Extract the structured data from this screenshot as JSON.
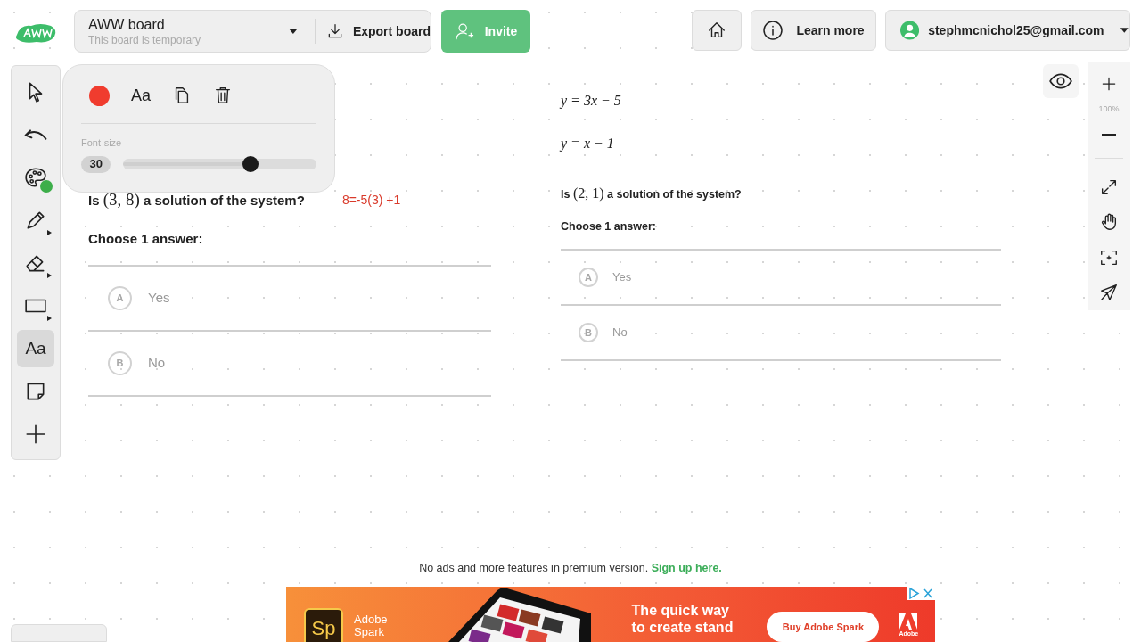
{
  "header": {
    "board_title": "AWW board",
    "board_subtitle": "This board is temporary",
    "export_label": "Export board",
    "invite_label": "Invite",
    "learn_more_label": "Learn more",
    "account_email": "stephmcnichol25@gmail.com"
  },
  "toolbar": {
    "tools": [
      {
        "kind": "select",
        "selected": false,
        "submenu": false
      },
      {
        "kind": "undo",
        "selected": false,
        "submenu": false
      },
      {
        "kind": "palette",
        "selected": false,
        "submenu": false
      },
      {
        "kind": "pencil",
        "selected": false,
        "submenu": true
      },
      {
        "kind": "eraser",
        "selected": false,
        "submenu": true
      },
      {
        "kind": "rectangle",
        "selected": false,
        "submenu": true
      },
      {
        "kind": "text",
        "label": "Aa",
        "selected": true,
        "submenu": false
      },
      {
        "kind": "note",
        "selected": false,
        "submenu": false
      },
      {
        "kind": "add",
        "selected": false,
        "submenu": false
      }
    ]
  },
  "text_popup": {
    "color": "#f03c2e",
    "font_label": "Aa",
    "font_size_label": "Font-size",
    "font_size": "30",
    "level": 0.66
  },
  "questions": [
    {
      "prompt_before": "Is",
      "point": "(3, 8)",
      "prompt_after": "a solution of the system?",
      "note": "8=-5(3) +1",
      "choose_label": "Choose 1 answer:",
      "choices": [
        {
          "letter": "A",
          "text": "Yes"
        },
        {
          "letter": "B",
          "text": "No"
        }
      ]
    },
    {
      "equations": [
        "y = 3x − 5",
        "y = x − 1"
      ],
      "prompt_before": "Is",
      "point": "(2, 1)",
      "prompt_after": "a solution of the system?",
      "choose_label": "Choose 1 answer:",
      "choices": [
        {
          "letter": "A",
          "text": "Yes"
        },
        {
          "letter": "B",
          "text": "No"
        }
      ]
    }
  ],
  "zoom": {
    "level_label": "100%"
  },
  "footer": {
    "notice": "No ads and more features in premium version.",
    "link": "Sign up here."
  },
  "ad": {
    "logo": "Sp",
    "brand_lines": [
      "Adobe",
      "Spark"
    ],
    "headline_lines": [
      "The quick way",
      "to create stand"
    ],
    "button": "Buy Adobe Spark",
    "maker": "Adobe"
  }
}
